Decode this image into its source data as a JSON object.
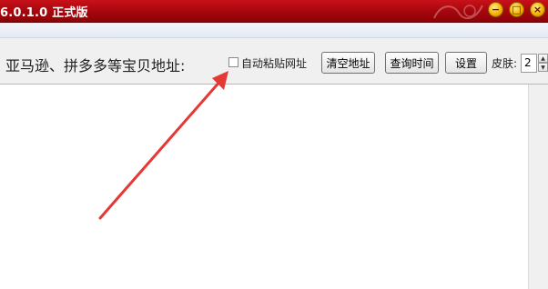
{
  "window": {
    "title": "6.0.1.0 正式版",
    "minimize_icon": "minimize-icon",
    "maximize_icon": "maximize-icon",
    "close_icon": "close-icon",
    "title_color": "#a4060c"
  },
  "toolbar": {
    "address_label": "亚马逊、拼多多等宝贝地址:",
    "auto_paste_label": "自动粘贴网址",
    "auto_paste_checked": false,
    "clear_button": "清空地址",
    "query_time_button": "查询时间",
    "settings_button": "设置",
    "skin_label": "皮肤:",
    "skin_value": "2"
  },
  "annotation": {
    "arrow_color": "#e53935"
  }
}
